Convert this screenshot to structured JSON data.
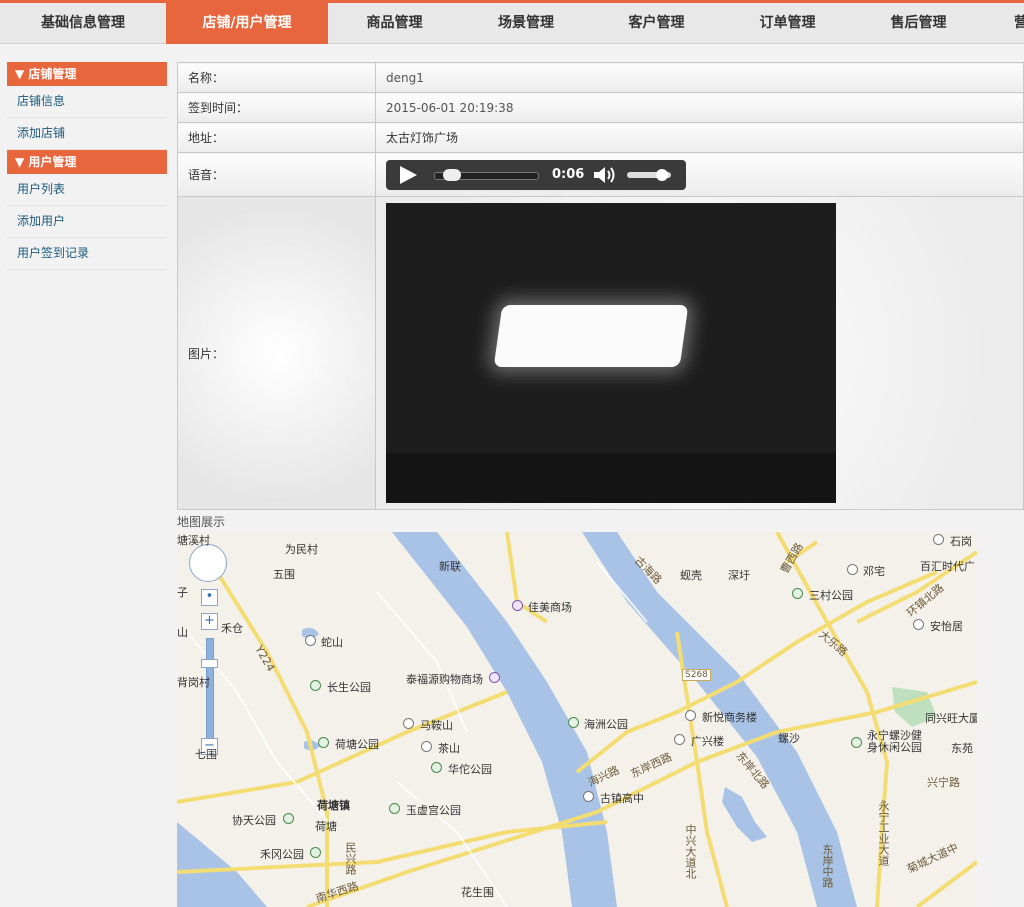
{
  "nav": {
    "items": [
      {
        "label": "基础信息管理"
      },
      {
        "label": "店铺/用户管理",
        "active": true
      },
      {
        "label": "商品管理"
      },
      {
        "label": "场景管理"
      },
      {
        "label": "客户管理"
      },
      {
        "label": "订单管理"
      },
      {
        "label": "售后管理"
      },
      {
        "label": "营"
      }
    ]
  },
  "sidebar": {
    "groups": [
      {
        "title": "▼ 店铺管理",
        "items": [
          "店铺信息",
          "添加店铺"
        ]
      },
      {
        "title": "▼ 用户管理",
        "items": [
          "用户列表",
          "添加用户",
          "用户签到记录"
        ]
      }
    ]
  },
  "detail": {
    "name_label": "名称：",
    "name_value": "deng1",
    "time_label": "签到时间：",
    "time_value": "2015-06-01 20:19:38",
    "address_label": "地址：",
    "address_value": "太古灯饰广场",
    "voice_label": "语音：",
    "voice_time": "0:06",
    "audio_progress": 0.1,
    "volume_level": 0.8,
    "image_label": "图片："
  },
  "map": {
    "title": "地图展示",
    "labels": [
      {
        "text": "塘溪村"
      },
      {
        "text": "为民村"
      },
      {
        "text": "新联"
      },
      {
        "text": "五围"
      },
      {
        "text": "佳美商场"
      },
      {
        "text": "蚬壳"
      },
      {
        "text": "深圩"
      },
      {
        "text": "三村公园"
      },
      {
        "text": "邓宅"
      },
      {
        "text": "石岗"
      },
      {
        "text": "百汇时代广"
      },
      {
        "text": "安怡居"
      },
      {
        "text": "禾仓"
      },
      {
        "text": "蛇山"
      },
      {
        "text": "长生公园"
      },
      {
        "text": "泰福源购物商场"
      },
      {
        "text": "海洲公园"
      },
      {
        "text": "新悦商务楼"
      },
      {
        "text": "广兴楼"
      },
      {
        "text": "螺沙"
      },
      {
        "text": "永宁螺沙健身休闲公园"
      },
      {
        "text": "同兴旺大厦"
      },
      {
        "text": "东苑"
      },
      {
        "text": "马鞍山"
      },
      {
        "text": "荷塘公园"
      },
      {
        "text": "茶山"
      },
      {
        "text": "华佗公园"
      },
      {
        "text": "古镇高中"
      },
      {
        "text": "荷塘镇"
      },
      {
        "text": "玉虚宫公园"
      },
      {
        "text": "协天公园"
      },
      {
        "text": "荷塘"
      },
      {
        "text": "禾冈公园"
      },
      {
        "text": "花生围"
      },
      {
        "text": "七围"
      },
      {
        "text": "子"
      },
      {
        "text": "山"
      },
      {
        "text": "背岗村"
      }
    ],
    "roads": [
      {
        "text": "环镇北路"
      },
      {
        "text": "大乐路"
      },
      {
        "text": "兴宁路"
      },
      {
        "text": "永宁工业大道"
      },
      {
        "text": "菊城大道中"
      },
      {
        "text": "东岸中路"
      },
      {
        "text": "东岸北路"
      },
      {
        "text": "中兴大道北"
      },
      {
        "text": "东岸西路"
      },
      {
        "text": "海兴路"
      },
      {
        "text": "民兴路"
      },
      {
        "text": "南华西路"
      },
      {
        "text": "S268"
      },
      {
        "text": "Y224"
      },
      {
        "text": "古海路"
      },
      {
        "text": "曹西路"
      }
    ]
  }
}
